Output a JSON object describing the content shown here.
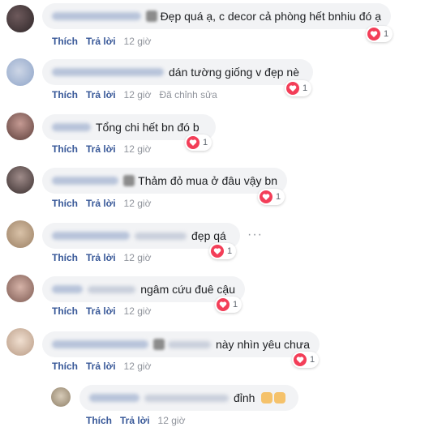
{
  "comments": [
    {
      "text": "Đẹp quá ạ, c decor cả phòng hết bnhiu đó ạ",
      "likes": "1",
      "like": "Thích",
      "reply": "Trả lời",
      "time": "12 giờ"
    },
    {
      "text": "dán tường giống v đẹp nè",
      "likes": "1",
      "like": "Thích",
      "reply": "Trả lời",
      "time": "12 giờ",
      "edited": "Đã chỉnh sửa"
    },
    {
      "text": "Tổng chi hết bn đó b",
      "likes": "1",
      "like": "Thích",
      "reply": "Trả lời",
      "time": "12 giờ"
    },
    {
      "text": "Thảm đỏ mua ở đâu vậy bn",
      "likes": "1",
      "like": "Thích",
      "reply": "Trả lời",
      "time": "12 giờ"
    },
    {
      "text": "đẹp qá",
      "likes": "1",
      "like": "Thích",
      "reply": "Trả lời",
      "time": "12 giờ"
    },
    {
      "text": "ngâm cứu đuê cậu",
      "likes": "1",
      "like": "Thích",
      "reply": "Trả lời",
      "time": "12 giờ"
    },
    {
      "text": "này nhìn yêu chưa",
      "likes": "1",
      "like": "Thích",
      "reply": "Trả lời",
      "time": "12 giờ"
    },
    {
      "text": "đỉnh",
      "like": "Thích",
      "reply": "Trả lời",
      "time": "12 giờ"
    }
  ],
  "colors": {
    "link": "#385898",
    "heart": "#f33e58",
    "bubble": "#f2f3f5"
  }
}
